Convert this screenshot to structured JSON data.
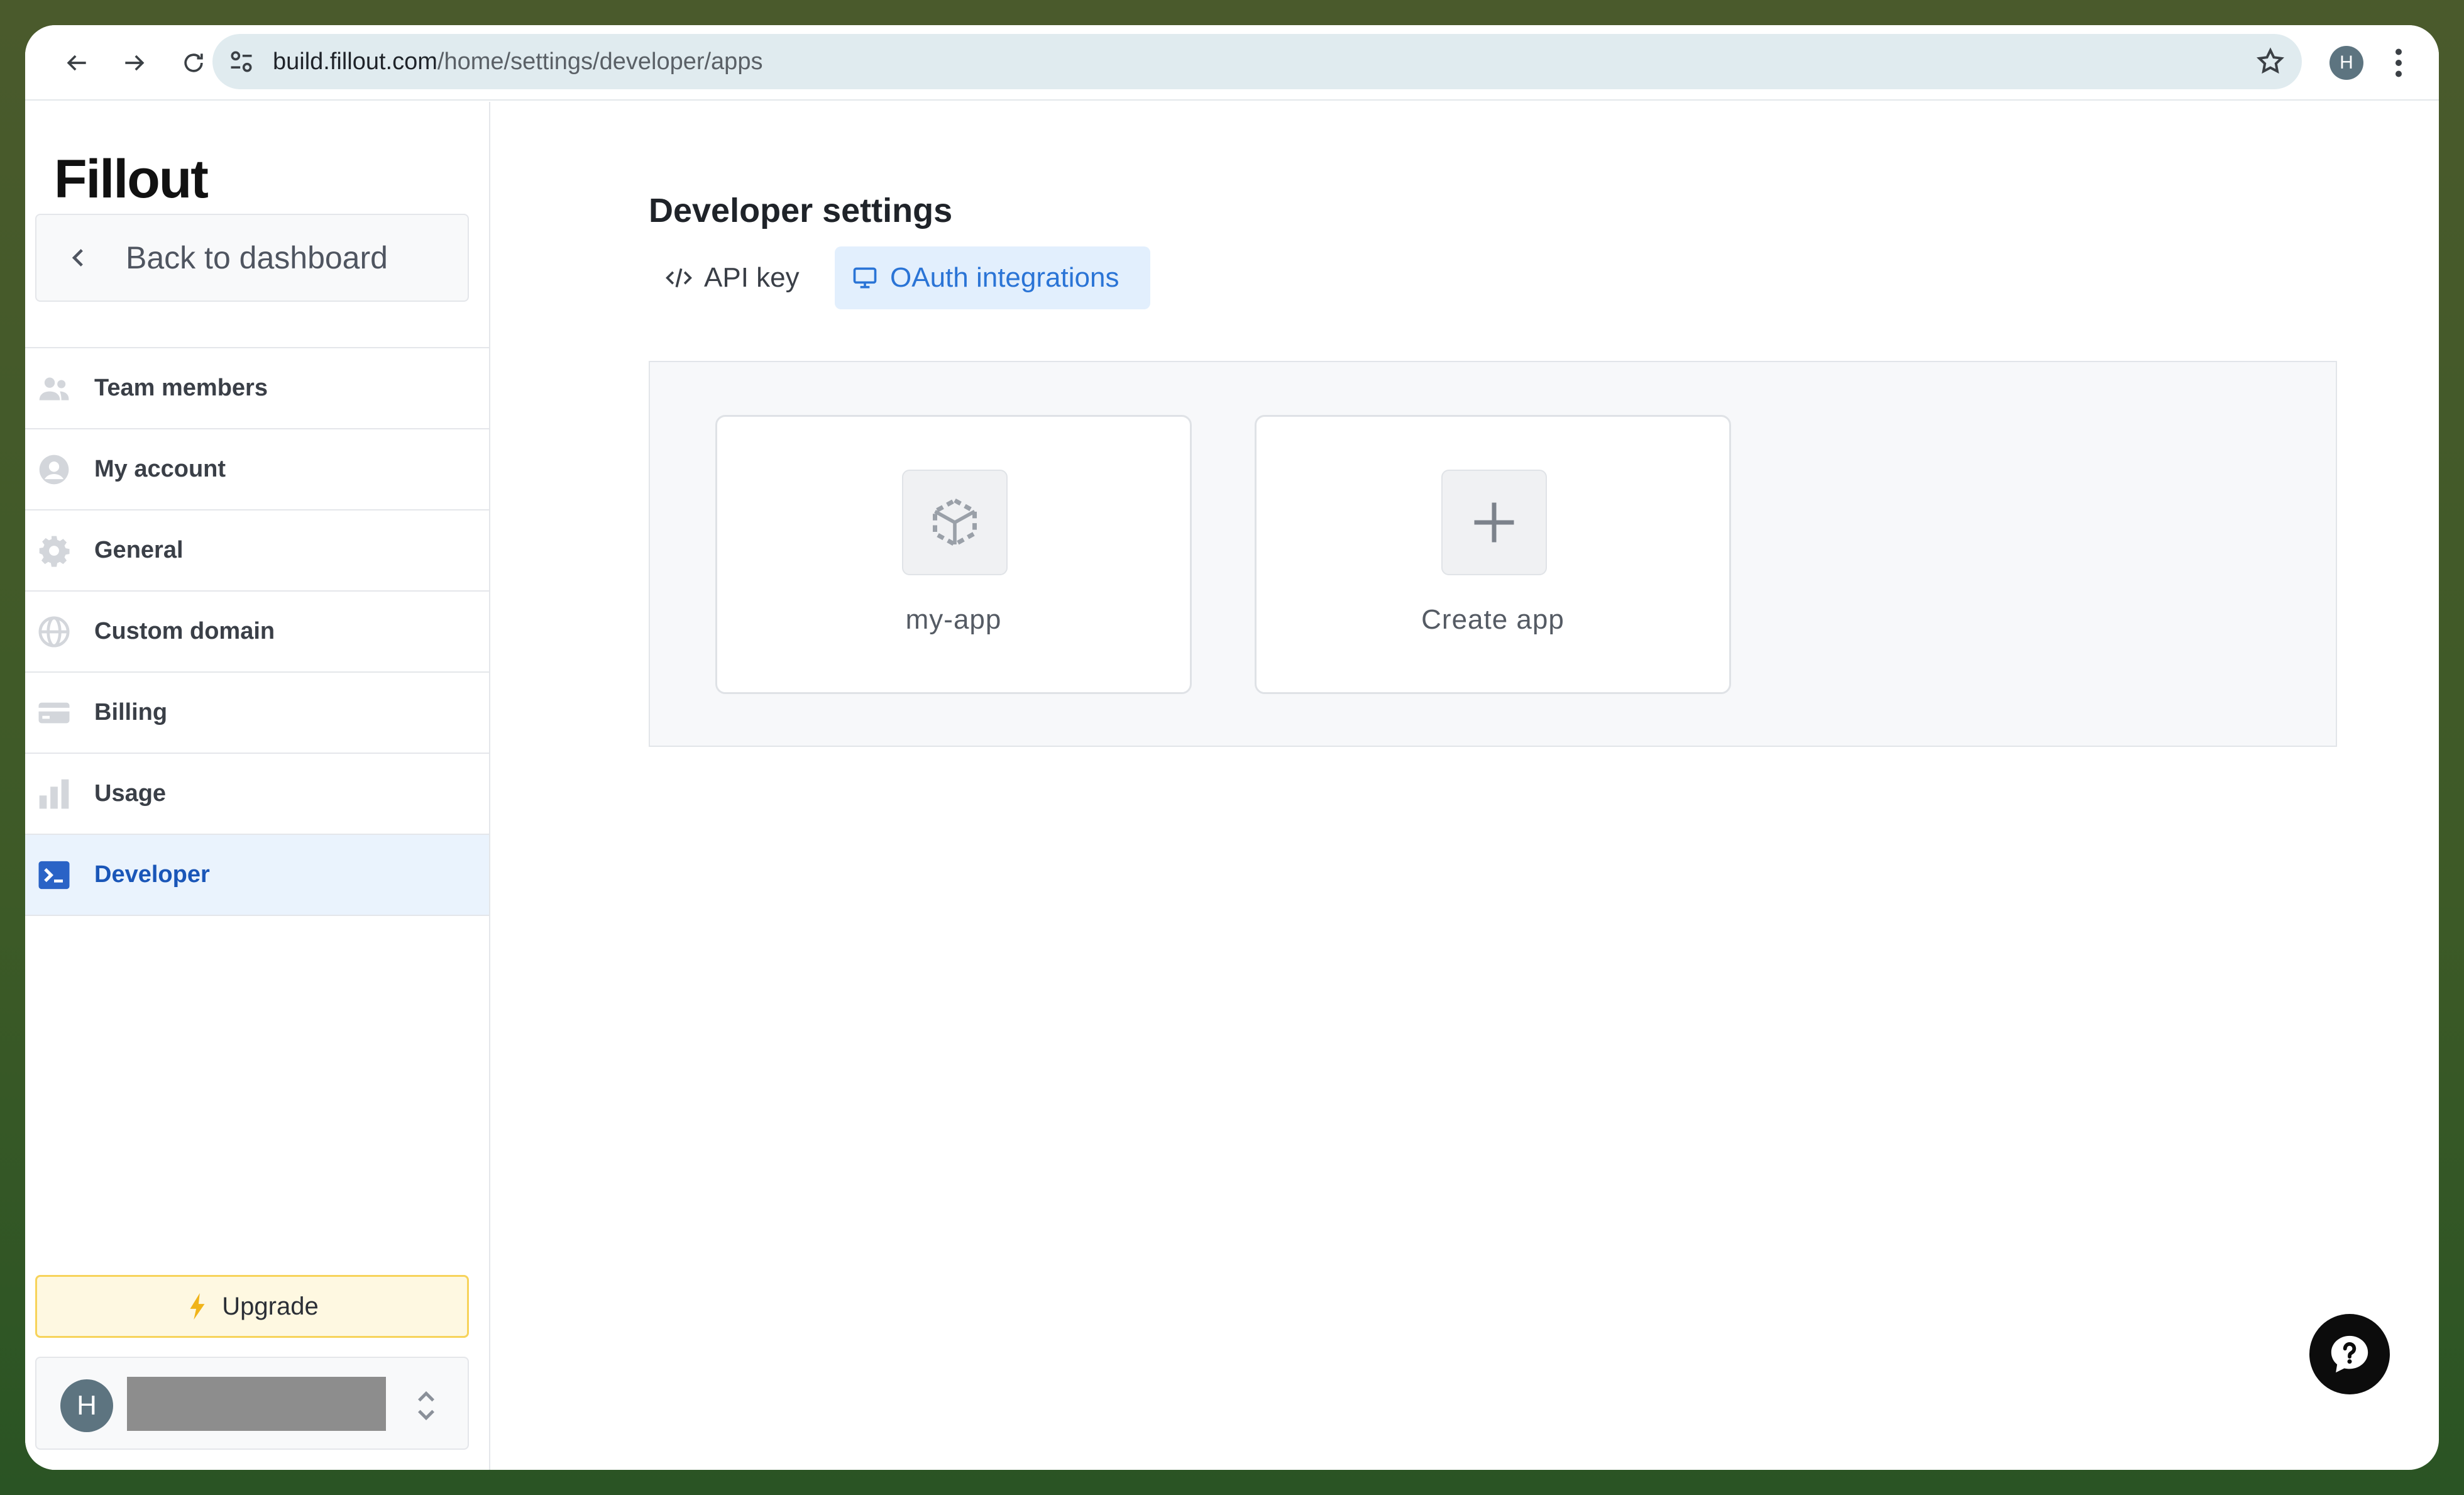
{
  "browser": {
    "url_host": "build.fillout.com",
    "url_path": "/home/settings/developer/apps",
    "profile_initial": "H"
  },
  "sidebar": {
    "logo": "Fillout",
    "back_label": "Back to dashboard",
    "items": [
      {
        "label": "Team members",
        "icon": "team-icon"
      },
      {
        "label": "My account",
        "icon": "account-icon"
      },
      {
        "label": "General",
        "icon": "gear-icon"
      },
      {
        "label": "Custom domain",
        "icon": "globe-icon"
      },
      {
        "label": "Billing",
        "icon": "card-icon"
      },
      {
        "label": "Usage",
        "icon": "bar-chart-icon"
      },
      {
        "label": "Developer",
        "icon": "terminal-icon",
        "active": true
      }
    ],
    "upgrade_label": "Upgrade",
    "account": {
      "initial": "H",
      "name": "…"
    }
  },
  "main": {
    "title": "Developer settings",
    "tabs": [
      {
        "label": "API key",
        "icon": "code-icon",
        "active": false
      },
      {
        "label": "OAuth integrations",
        "icon": "monitor-icon",
        "active": true
      }
    ],
    "apps": [
      {
        "label": "my-app",
        "icon": "app-cube-icon"
      },
      {
        "label": "Create app",
        "icon": "plus-icon"
      }
    ]
  },
  "colors": {
    "accent": "#2a74d6",
    "active_bg": "#eaf3fd",
    "upgrade_bg": "#fef8e1",
    "upgrade_border": "#f7d35a"
  }
}
